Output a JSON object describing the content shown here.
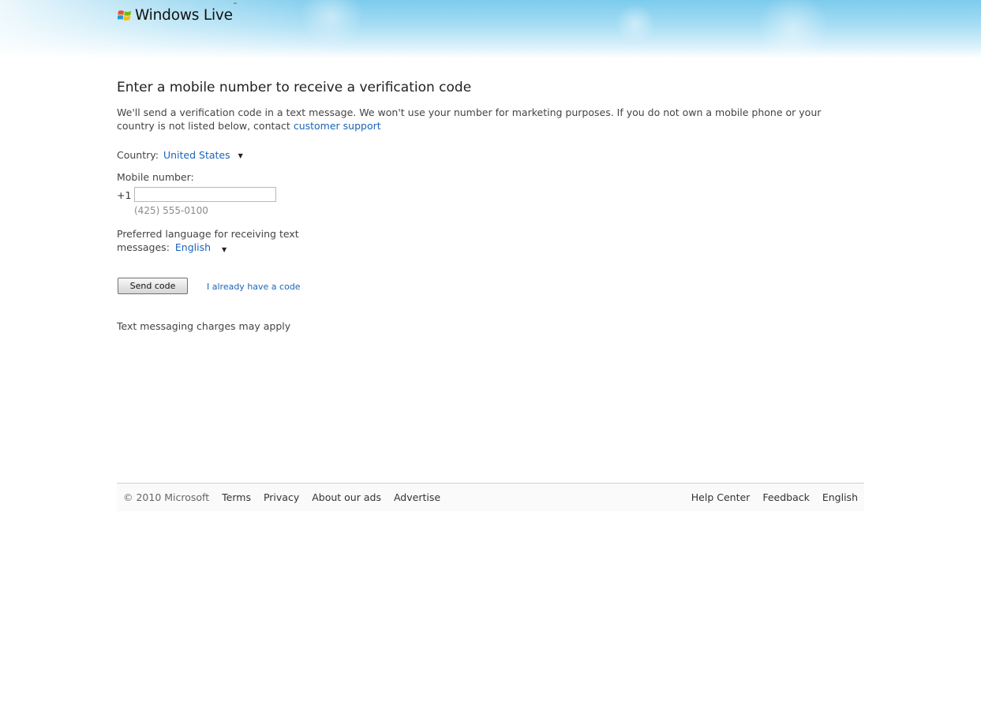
{
  "header": {
    "logo_text": "Windows Live",
    "logo_tm": "™",
    "logo_icon": "windows-flag-icon",
    "brand_colors": {
      "red": "#e8502a",
      "green": "#7ab800",
      "blue": "#1f9ad6",
      "yellow": "#ffbb00"
    }
  },
  "main": {
    "title": "Enter a mobile number to receive a verification code",
    "intro_text": "We'll send a verification code in a text message.  We won't use your number for marketing purposes.  If you do not own a mobile phone or your country is not listed below, contact",
    "support_link": "customer support",
    "country": {
      "label": "Country:",
      "value": "United States",
      "caret": "▼"
    },
    "mobile": {
      "label": "Mobile number:",
      "prefix": "+1",
      "value": "",
      "placeholder": "",
      "hint": "(425) 555-0100"
    },
    "language": {
      "label": "Preferred language for receiving text messages:",
      "value": "English",
      "caret": "▼"
    },
    "send_button": "Send code",
    "have_code_link": "I already have a code",
    "charges_note": "Text messaging charges may apply"
  },
  "footer": {
    "copyright": "© 2010 Microsoft",
    "left_links": [
      "Terms",
      "Privacy",
      "About our ads",
      "Advertise"
    ],
    "right_links": [
      "Help Center",
      "Feedback",
      "English"
    ]
  },
  "colors": {
    "link": "#1a64b9",
    "text": "#444444",
    "header_sky": "#7ccbec"
  }
}
